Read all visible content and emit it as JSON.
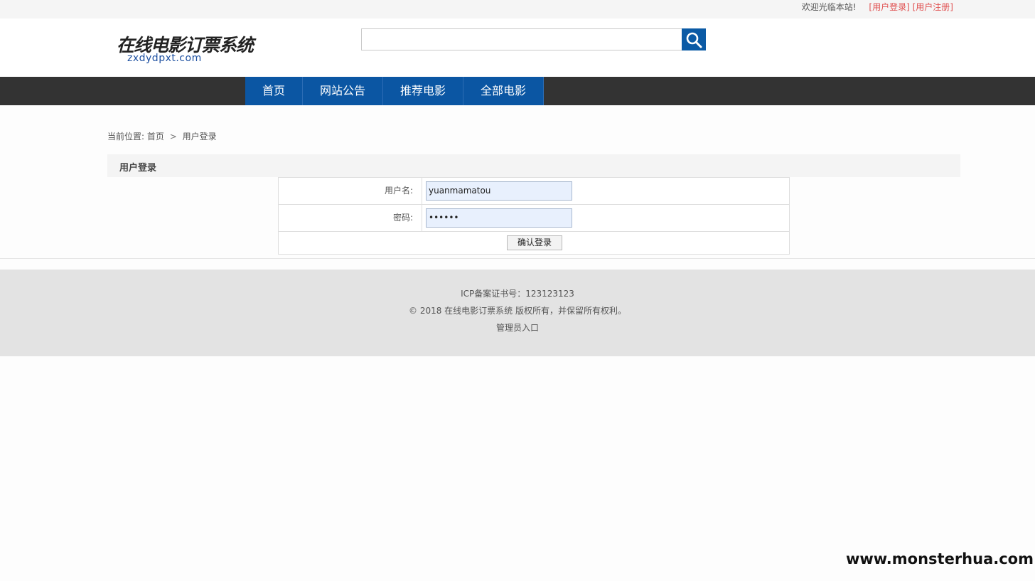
{
  "topbar": {
    "welcome": "欢迎光临本站!",
    "login_link": "[用户登录]",
    "register_link": "[用户注册]"
  },
  "header": {
    "logo_name": "在线电影订票系统",
    "logo_domain": "zxdydpxt.com",
    "search": {
      "value": "",
      "placeholder": ""
    },
    "search_icon": "search-icon"
  },
  "nav": {
    "items": [
      {
        "label": "首页"
      },
      {
        "label": "网站公告"
      },
      {
        "label": "推荐电影"
      },
      {
        "label": "全部电影"
      }
    ]
  },
  "breadcrumb": {
    "prefix": "当前位置:",
    "home": "首页",
    "separator": ">",
    "current": "用户登录"
  },
  "section": {
    "title": "用户登录"
  },
  "form": {
    "username_label": "用户名:",
    "username_value": "yuanmamatou",
    "password_label": "密码:",
    "password_value": "••••••",
    "submit_label": "确认登录"
  },
  "footer": {
    "icp": "ICP备案证书号：123123123",
    "copyright": "© 2018 在线电影订票系统 版权所有，并保留所有权利。",
    "admin_link": "管理员入口"
  },
  "watermark": "www.monsterhua.com",
  "colors": {
    "nav_background": "#333333",
    "nav_item": "#0b56a3",
    "search_button": "#0b5aa5",
    "link_red": "#e04f4f",
    "footer_background": "#e3e3e3"
  }
}
